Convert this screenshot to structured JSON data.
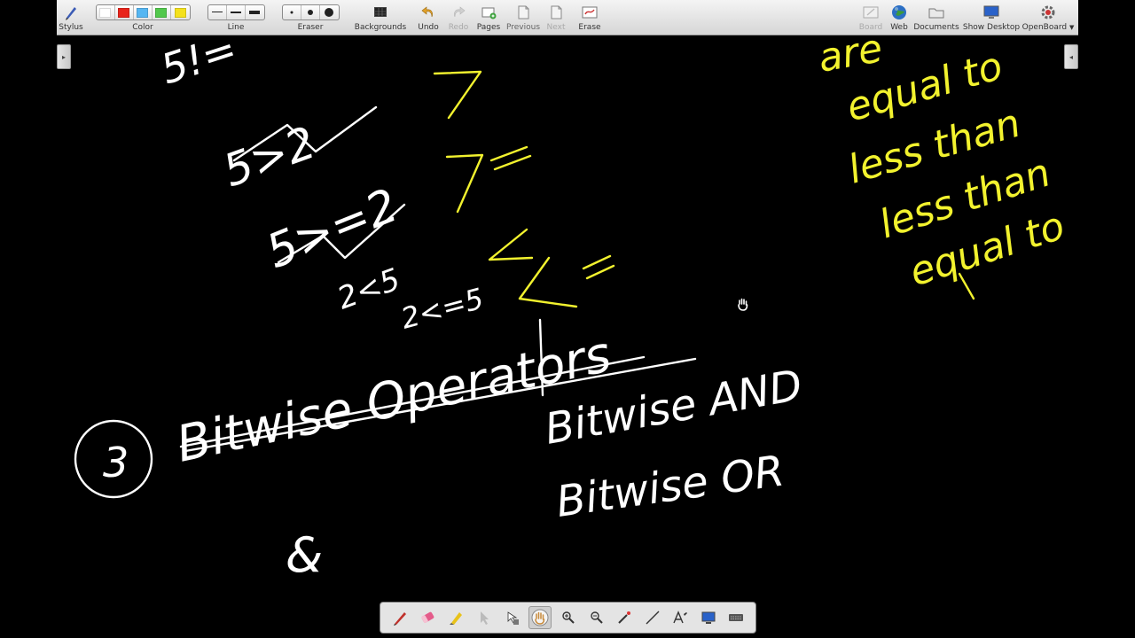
{
  "toolbar": {
    "stylus": "Stylus",
    "color": "Color",
    "line": "Line",
    "eraser": "Eraser",
    "backgrounds": "Backgrounds",
    "undo": "Undo",
    "redo": "Redo",
    "pages": "Pages",
    "previous": "Previous",
    "next": "Next",
    "erase": "Erase",
    "board": "Board",
    "web": "Web",
    "documents": "Documents",
    "show_desktop": "Show Desktop",
    "openboard": "OpenBoard"
  },
  "colors": {
    "swatches": [
      "#ffffff",
      "#e8241b",
      "#55b6f2",
      "#52c84c",
      "#f4e11c"
    ],
    "ink_white": "#ffffff",
    "ink_yellow": "#f2f22e",
    "toolbar_bg": "#e4e4e4"
  },
  "board": {
    "heading_number": "3",
    "heading_text": "Bitwise Operators",
    "item1": "Bitwise AND",
    "item2": "Bitwise OR",
    "symbol_and": "&",
    "expr_51": "5!=",
    "expr_gt": "5>2",
    "expr_ge": "5>=2",
    "expr_lt": "2<5",
    "expr_le": "2<=5",
    "op_gt": "7",
    "op_ge": "7=",
    "op_lt": "<",
    "op_le": "< =",
    "note_lines": [
      "are",
      "equal to",
      "less than",
      "less than",
      "equal to"
    ]
  },
  "palette": {
    "tools": [
      "pen-icon",
      "eraser-icon",
      "highlighter-icon",
      "selector-icon",
      "interactor-icon",
      "hand-icon",
      "zoom-in-icon",
      "zoom-out-icon",
      "laser-pointer-icon",
      "line-icon",
      "text-icon",
      "capture-icon",
      "keyboard-icon"
    ],
    "active": "hand-icon"
  }
}
